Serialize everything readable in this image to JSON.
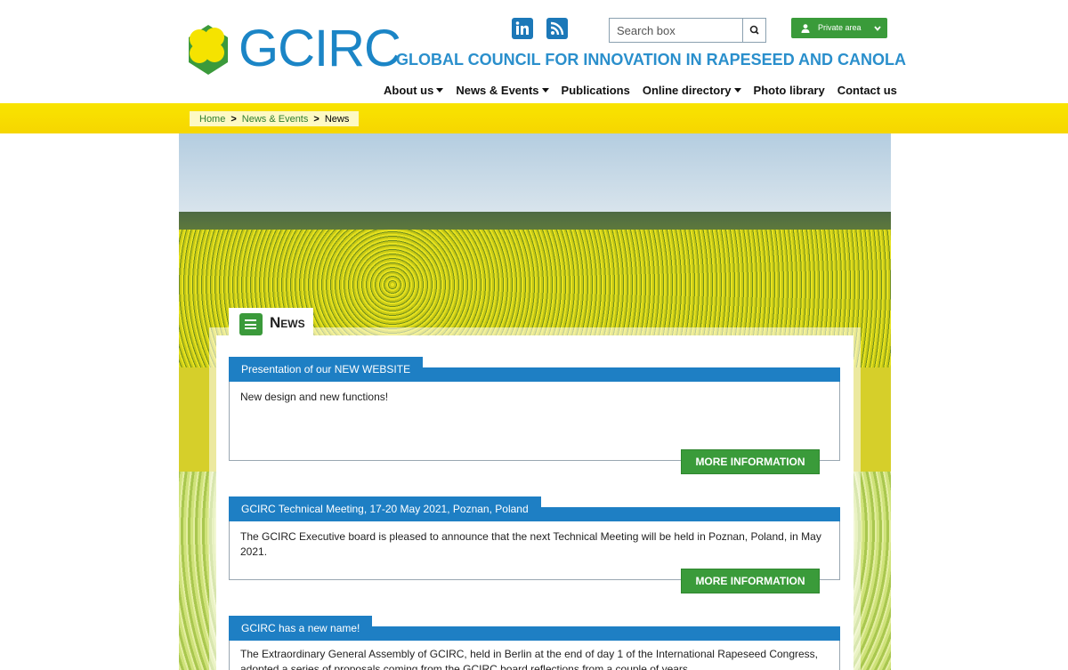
{
  "header": {
    "logo_text": "GCIRC",
    "tagline": "GLOBAL COUNCIL FOR INNOVATION IN RAPESEED AND CANOLA",
    "search": {
      "placeholder": "Search box"
    },
    "private_area": "Private area"
  },
  "nav": {
    "items": [
      {
        "label": "About us",
        "dropdown": true
      },
      {
        "label": "News & Events",
        "dropdown": true
      },
      {
        "label": "Publications",
        "dropdown": false
      },
      {
        "label": "Online directory",
        "dropdown": true
      },
      {
        "label": "Photo library",
        "dropdown": false
      },
      {
        "label": "Contact us",
        "dropdown": false
      }
    ]
  },
  "breadcrumb": {
    "home": "Home",
    "sep": ">",
    "section": "News & Events",
    "current": "News"
  },
  "panel": {
    "title": "News"
  },
  "news": [
    {
      "title": "Presentation of our NEW WEBSITE",
      "text": "New design and new functions!",
      "button": "MORE INFORMATION"
    },
    {
      "title": "GCIRC Technical Meeting, 17-20 May 2021, Poznan, Poland",
      "text": "The GCIRC Executive board is pleased to announce that the next Technical Meeting will be held in Poznan, Poland, in May 2021.",
      "button": "MORE INFORMATION"
    },
    {
      "title": "GCIRC has a new name!",
      "text": "The Extraordinary General Assembly of GCIRC, held in Berlin at the end of day 1 of the International Rapeseed Congress, adopted a series of proposals coming from the GCIRC board reflections from a couple of years."
    }
  ],
  "colors": {
    "brand_blue": "#1b85c6",
    "accent_green": "#3a9b3a",
    "band_yellow": "#f9e400"
  }
}
